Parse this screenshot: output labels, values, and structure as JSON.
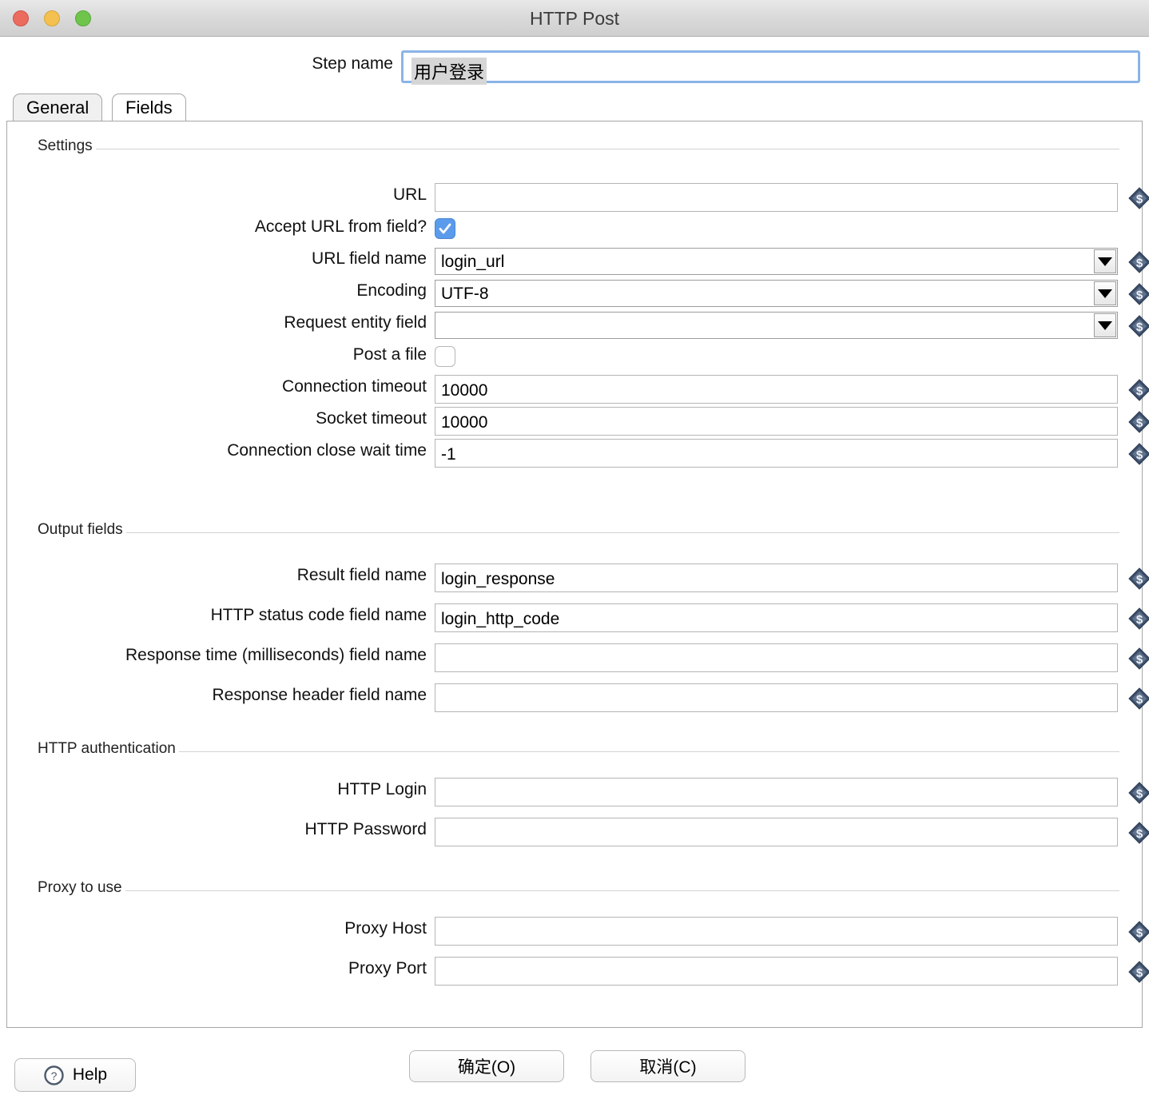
{
  "window": {
    "title": "HTTP Post",
    "traffic_lights": [
      "close-button",
      "minimize-button",
      "zoom-button"
    ]
  },
  "step_name": {
    "label": "Step name",
    "value": "用户登录"
  },
  "tabs": [
    {
      "label": "General",
      "selected": true
    },
    {
      "label": "Fields",
      "selected": false
    }
  ],
  "groups": {
    "settings": {
      "title": "Settings",
      "rows": [
        {
          "label": "URL",
          "type": "text",
          "value": "",
          "dollar": true
        },
        {
          "label": "Accept URL from field?",
          "type": "checkbox",
          "checked": true,
          "dollar": false
        },
        {
          "label": "URL field name",
          "type": "combo",
          "value": "login_url",
          "dollar": true
        },
        {
          "label": "Encoding",
          "type": "combo",
          "value": "UTF-8",
          "dollar": true
        },
        {
          "label": "Request entity field",
          "type": "combo",
          "value": "",
          "dollar": true
        },
        {
          "label": "Post a file",
          "type": "checkbox",
          "checked": false,
          "dollar": false
        },
        {
          "label": "Connection timeout",
          "type": "text",
          "value": "10000",
          "dollar": true
        },
        {
          "label": "Socket timeout",
          "type": "text",
          "value": "10000",
          "dollar": true
        },
        {
          "label": "Connection close wait time",
          "type": "text",
          "value": "-1",
          "dollar": true
        }
      ]
    },
    "output_fields": {
      "title": "Output fields",
      "rows": [
        {
          "label": "Result field name",
          "type": "text",
          "value": "login_response",
          "dollar": true
        },
        {
          "label": "HTTP status code field name",
          "type": "text",
          "value": "login_http_code",
          "dollar": true
        },
        {
          "label": "Response time (milliseconds) field name",
          "type": "text",
          "value": "",
          "dollar": true
        },
        {
          "label": "Response header field name",
          "type": "text",
          "value": "",
          "dollar": true
        }
      ]
    },
    "http_authentication": {
      "title": "HTTP authentication",
      "rows": [
        {
          "label": "HTTP Login",
          "type": "text",
          "value": "",
          "dollar": true
        },
        {
          "label": "HTTP Password",
          "type": "text",
          "value": "",
          "dollar": true
        }
      ]
    },
    "proxy": {
      "title": "Proxy to use",
      "rows": [
        {
          "label": "Proxy Host",
          "type": "text",
          "value": "",
          "dollar": true
        },
        {
          "label": "Proxy Port",
          "type": "text",
          "value": "",
          "dollar": true
        }
      ]
    }
  },
  "buttons": {
    "help": "Help",
    "ok": "确定(O)",
    "cancel": "取消(C)"
  },
  "icons": {
    "help": "question-mark-icon",
    "variable": "dollar-variable-icon",
    "dropdown": "chevron-down-icon",
    "check": "checkmark-icon"
  },
  "colors": {
    "checkbox_on": "#5b9bec",
    "focus_border": "#8ab4e8",
    "variable_icon": "#3c4f6b"
  }
}
